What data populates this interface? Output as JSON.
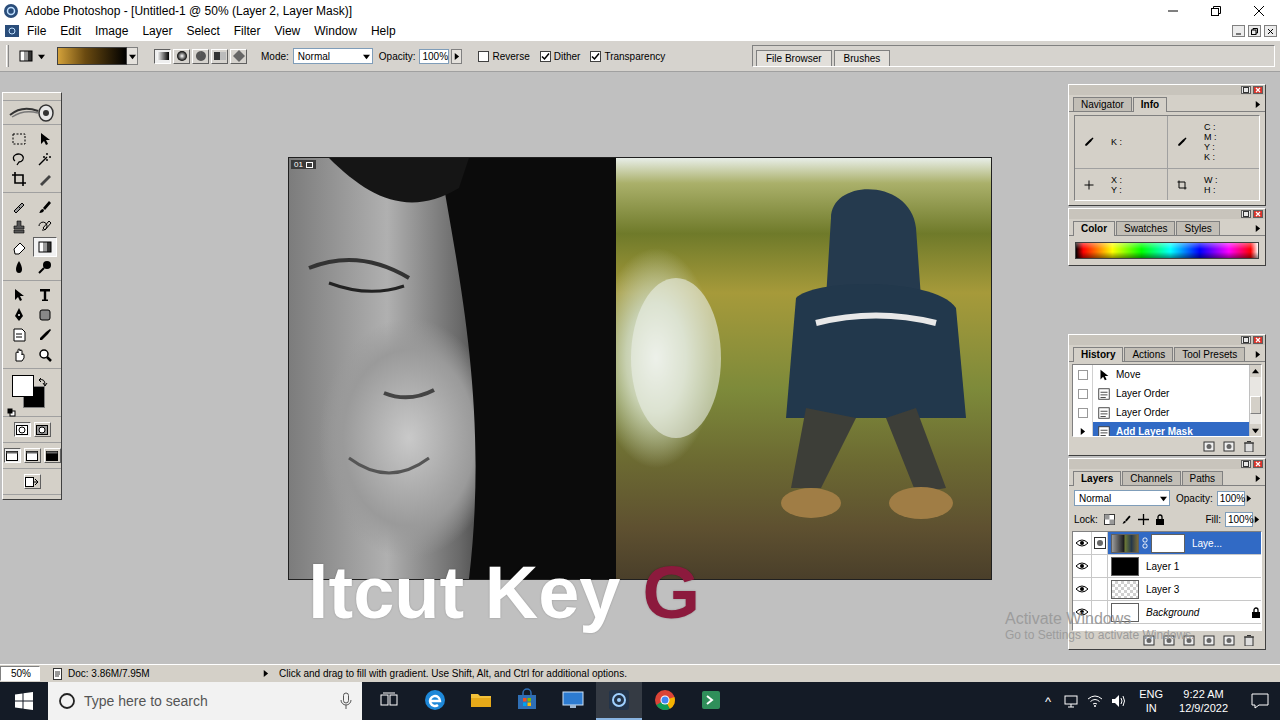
{
  "window": {
    "title": "Adobe Photoshop - [Untitled-1 @ 50% (Layer 2, Layer Mask)]"
  },
  "menu": [
    "File",
    "Edit",
    "Image",
    "Layer",
    "Select",
    "Filter",
    "View",
    "Window",
    "Help"
  ],
  "options_bar": {
    "gradient_types": [
      {
        "selected": true
      },
      {
        "selected": false
      },
      {
        "selected": false
      },
      {
        "selected": false
      },
      {
        "selected": false
      }
    ],
    "mode_label": "Mode:",
    "mode": "Normal",
    "opacity_label": "Opacity:",
    "opacity": "100%",
    "checkboxes": [
      {
        "label": "Reverse",
        "checked": false
      },
      {
        "label": "Dither",
        "checked": true
      },
      {
        "label": "Transparency",
        "checked": true
      }
    ]
  },
  "palette_well": {
    "tabs": [
      "File Browser",
      "Brushes"
    ]
  },
  "toolbox": {
    "tool_groups": [
      [
        {
          "selected": false
        },
        {
          "selected": false
        },
        {
          "selected": false
        },
        {
          "selected": false
        },
        {
          "selected": false
        },
        {
          "selected": false
        }
      ],
      [
        {
          "selected": false
        },
        {
          "selected": false
        },
        {
          "selected": false
        },
        {
          "selected": false
        },
        {
          "selected": false
        },
        {
          "selected": true
        },
        {
          "selected": false
        },
        {
          "selected": false
        }
      ],
      [
        {
          "selected": false
        },
        {
          "selected": false
        },
        {
          "selected": false
        },
        {
          "selected": false
        },
        {
          "selected": false
        },
        {
          "selected": false
        },
        {
          "selected": false
        },
        {
          "selected": false
        }
      ]
    ]
  },
  "document": {
    "label": "01"
  },
  "caption": {
    "text": "ltcut Key",
    "accent": "G"
  },
  "info_panel": {
    "tabs": [
      {
        "label": "Navigator",
        "selected": false
      },
      {
        "label": "Info",
        "selected": true
      }
    ],
    "readouts": [
      {
        "labels": [
          "K :"
        ]
      },
      {
        "labels": [
          "C :",
          "M :",
          "Y :",
          "K :"
        ]
      },
      {
        "labels": [
          "X :",
          "Y :"
        ]
      },
      {
        "labels": [
          "W :",
          "H :"
        ]
      }
    ]
  },
  "color_panel": {
    "tabs": [
      {
        "label": "Color",
        "selected": true
      },
      {
        "label": "Swatches",
        "selected": false
      },
      {
        "label": "Styles",
        "selected": false
      }
    ]
  },
  "history_panel": {
    "tabs": [
      {
        "label": "History",
        "selected": true
      },
      {
        "label": "Actions",
        "selected": false
      },
      {
        "label": "Tool Presets",
        "selected": false
      }
    ],
    "items": [
      {
        "label": "Move",
        "kind": "move",
        "selected": false
      },
      {
        "label": "Layer Order",
        "kind": "layer",
        "selected": false
      },
      {
        "label": "Layer Order",
        "kind": "layer",
        "selected": false
      },
      {
        "label": "Add Layer Mask",
        "kind": "layer",
        "selected": true
      }
    ]
  },
  "layers_panel": {
    "tabs": [
      {
        "label": "Layers",
        "selected": true
      },
      {
        "label": "Channels",
        "selected": false
      },
      {
        "label": "Paths",
        "selected": false
      }
    ],
    "blend": "Normal",
    "opacity_label": "Opacity:",
    "opacity": "100%",
    "lock_label": "Lock:",
    "fill_label": "Fill:",
    "fill": "100%",
    "layers": [
      {
        "name": "Laye...",
        "selected": true,
        "visible": true,
        "thumb": "photo",
        "has_mask": true,
        "locked": false,
        "italic": false
      },
      {
        "name": "Layer 1",
        "selected": false,
        "visible": true,
        "thumb": "black",
        "has_mask": false,
        "locked": false,
        "italic": false
      },
      {
        "name": "Layer 3",
        "selected": false,
        "visible": true,
        "thumb": "transparent",
        "has_mask": false,
        "locked": false,
        "italic": false
      },
      {
        "name": "Background",
        "selected": false,
        "visible": true,
        "thumb": "white",
        "has_mask": false,
        "locked": true,
        "italic": true
      }
    ]
  },
  "watermark": {
    "title": "Activate Windows",
    "subtitle": "Go to Settings to activate Windows."
  },
  "status_bar": {
    "zoom": "50%",
    "doc": "Doc: 3.86M/7.95M",
    "hint": "Click and drag to fill with gradient. Use Shift, Alt, and Ctrl for additional options."
  },
  "taskbar": {
    "search_placeholder": "Type here to search",
    "apps": [
      {
        "kind": "task-view",
        "active": false
      },
      {
        "kind": "edge",
        "active": false
      },
      {
        "kind": "explorer",
        "active": false
      },
      {
        "kind": "store",
        "active": false
      },
      {
        "kind": "remote",
        "active": false
      },
      {
        "kind": "photoshop",
        "active": true
      },
      {
        "kind": "chrome",
        "active": false
      },
      {
        "kind": "terminal",
        "active": false
      }
    ],
    "tray_chevron": "^",
    "language": "ENG",
    "region": "IN",
    "time": "9:22 AM",
    "date": "12/9/2022"
  }
}
